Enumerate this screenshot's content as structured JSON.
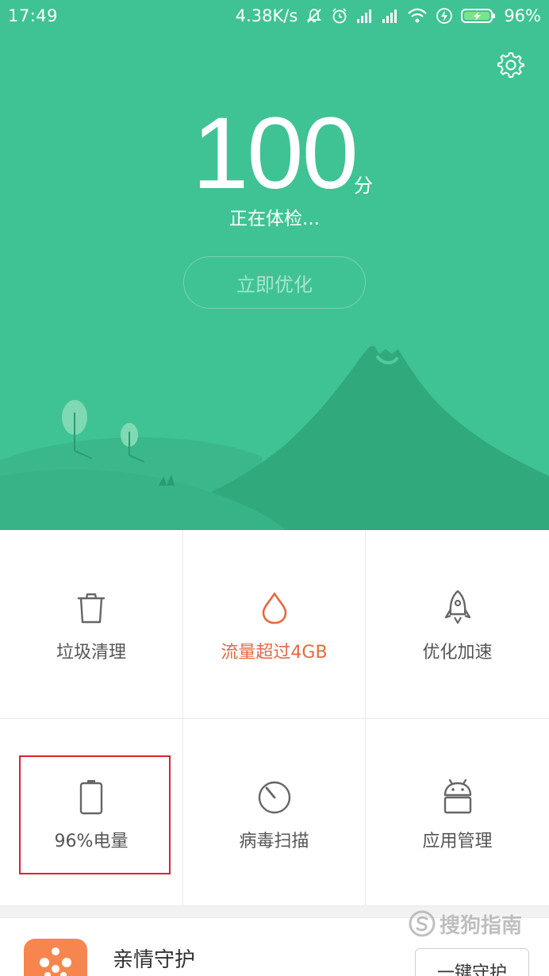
{
  "status_bar": {
    "time": "17:49",
    "network_speed": "4.38K/s",
    "battery_percent": "96%",
    "icons": [
      "mute-bell-icon",
      "alarm-icon",
      "signal-icon",
      "signal-icon",
      "wifi-icon",
      "charging-icon",
      "battery-icon"
    ]
  },
  "hero": {
    "score": "100",
    "score_unit": "分",
    "status": "正在体检...",
    "optimize_button": "立即优化",
    "settings_icon": "gear-icon",
    "background_color": "#3fc394"
  },
  "grid": {
    "items": [
      {
        "label": "垃圾清理",
        "icon": "trash-icon"
      },
      {
        "label": "流量超过4GB",
        "icon": "drop-icon",
        "color": "#e8683f"
      },
      {
        "label": "优化加速",
        "icon": "rocket-icon"
      },
      {
        "label": "96%电量",
        "icon": "battery-icon",
        "highlighted": true
      },
      {
        "label": "病毒扫描",
        "icon": "scan-icon"
      },
      {
        "label": "应用管理",
        "icon": "android-icon"
      }
    ]
  },
  "family_card": {
    "title": "亲情守护",
    "button": "一键守护",
    "icon": "family-guard-icon"
  },
  "watermark": {
    "text": "搜狗指南"
  }
}
